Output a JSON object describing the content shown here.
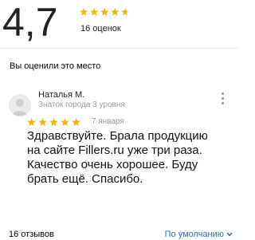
{
  "summary": {
    "rating": "4,7",
    "reviews_count_label": "16 оценок",
    "stars": 4.7
  },
  "my_review": {
    "section_title": "Вы оценили это место",
    "author": "Наталья М.",
    "badge": "Знаток города 3 уровня",
    "stars": 5,
    "date": "7 января",
    "text": "Здравствуйте. Брала продукцию на сайте Fillers.ru уже три раза. Качество очень хорошее. Буду брать ещё. Спасибо."
  },
  "reviews_footer": {
    "count_label": "16 отзывов",
    "sort_label": "По умолчанию"
  },
  "colors": {
    "star": "#f2b701",
    "link": "#2a6bd1"
  },
  "icons": {
    "more": "more-vertical-icon",
    "sort": "chevron-down-icon",
    "avatar": "user-icon"
  }
}
